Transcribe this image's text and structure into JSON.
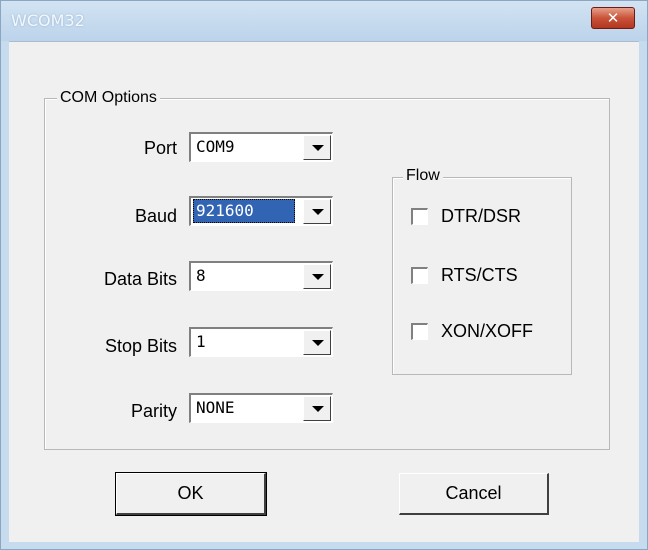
{
  "window": {
    "title": "WCOM32",
    "close_glyph": "✕",
    "close_icon": "close-icon"
  },
  "com_options": {
    "title": "COM Options",
    "port": {
      "label": "Port",
      "value": "COM9"
    },
    "baud": {
      "label": "Baud",
      "value": "921600",
      "selected": true
    },
    "data_bits": {
      "label": "Data Bits",
      "value": "8"
    },
    "stop_bits": {
      "label": "Stop Bits",
      "value": "1"
    },
    "parity": {
      "label": "Parity",
      "value": "NONE"
    }
  },
  "flow": {
    "title": "Flow",
    "options": [
      {
        "label": "DTR/DSR",
        "checked": false
      },
      {
        "label": "RTS/CTS",
        "checked": false
      },
      {
        "label": "XON/XOFF",
        "checked": false
      }
    ]
  },
  "buttons": {
    "ok": "OK",
    "cancel": "Cancel"
  },
  "colors": {
    "selection": "#3264b4",
    "title_bar": "#c7dbee",
    "close_button": "#c9533a"
  }
}
